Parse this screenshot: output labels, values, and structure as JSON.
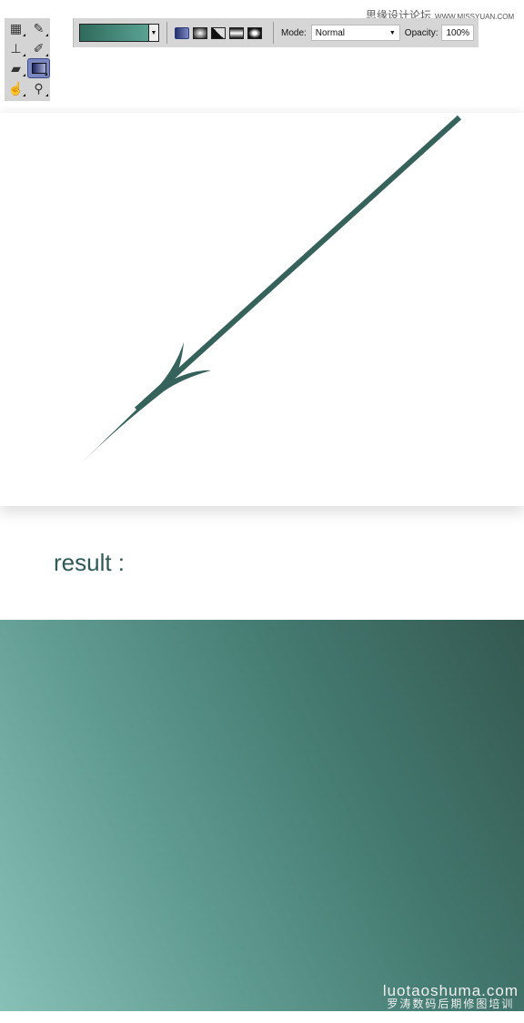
{
  "watermark": {
    "cn": "思缘设计论坛",
    "url": "WWW.MISSYUAN.COM"
  },
  "toolbox": {
    "tools": [
      "marquee-icon",
      "brush-icon",
      "stamp-icon",
      "history-brush-icon",
      "eraser-icon",
      "gradient-icon",
      "smudge-icon",
      "dodge-icon"
    ],
    "selected": "gradient-icon"
  },
  "options": {
    "gradient_colors": [
      "#2f6a5c",
      "#5aa292"
    ],
    "gradient_types": [
      "linear",
      "radial",
      "angle",
      "reflected",
      "diamond"
    ],
    "mode_label": "Mode:",
    "mode_value": "Normal",
    "opacity_label": "Opacity:",
    "opacity_value": "100%"
  },
  "arrow_color": "#35625a",
  "result_label": "result :",
  "result_gradient": [
    "#87c0b6",
    "#345850"
  ],
  "site": {
    "url": "luotaoshuma.com",
    "cn": "罗涛数码后期修图培训"
  }
}
